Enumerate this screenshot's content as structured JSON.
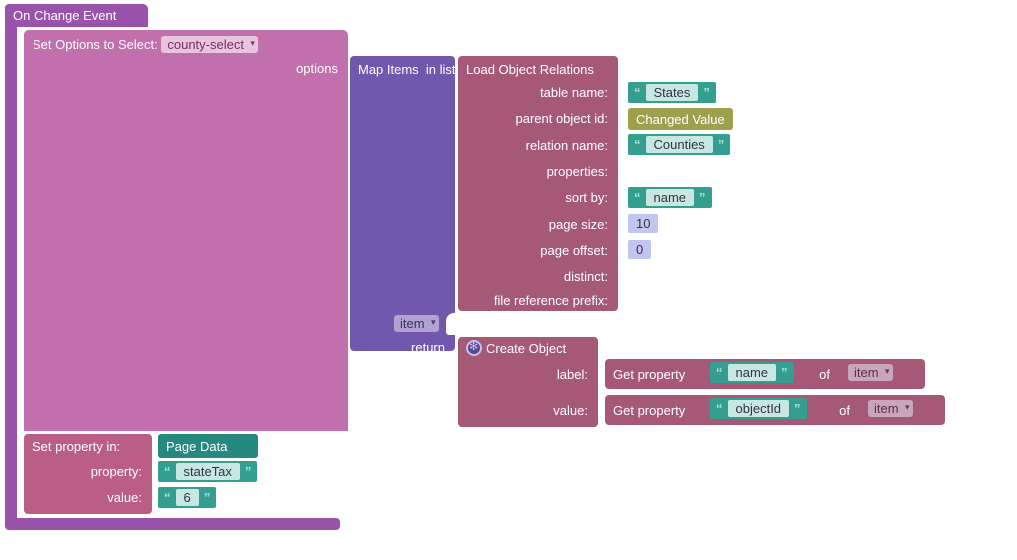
{
  "event": {
    "title": "On Change Event"
  },
  "setOptions": {
    "title": "Set Options to Select:",
    "selectId": "county-select",
    "optionsLabel": "options"
  },
  "mapItems": {
    "title": "Map Items",
    "inListLabel": "in list:",
    "itemVar": "item",
    "returnLabel": "return"
  },
  "loadRelations": {
    "title": "Load Object Relations",
    "fields": {
      "tableName": "table name:",
      "parentObjectId": "parent object id:",
      "relationName": "relation name:",
      "properties": "properties:",
      "sortBy": "sort by:",
      "pageSize": "page size:",
      "pageOffset": "page offset:",
      "distinct": "distinct:",
      "fileRefPrefix": "file reference prefix:"
    },
    "values": {
      "tableName": "States",
      "parentObjectId": "Changed Value",
      "relationName": "Counties",
      "sortBy": "name",
      "pageSize": "10",
      "pageOffset": "0"
    }
  },
  "createObject": {
    "title": "Create Object",
    "labelField": "label:",
    "valueField": "value:"
  },
  "getProp": {
    "title": "Get property",
    "of": "of",
    "labelProp": "name",
    "labelOfVar": "item",
    "valueProp": "objectId",
    "valueOfVar": "item"
  },
  "setProperty": {
    "title": "Set property in:",
    "target": "Page Data",
    "propertyLabel": "property:",
    "valueLabel": "value:",
    "propertyName": "stateTax",
    "propertyValue": "6"
  }
}
